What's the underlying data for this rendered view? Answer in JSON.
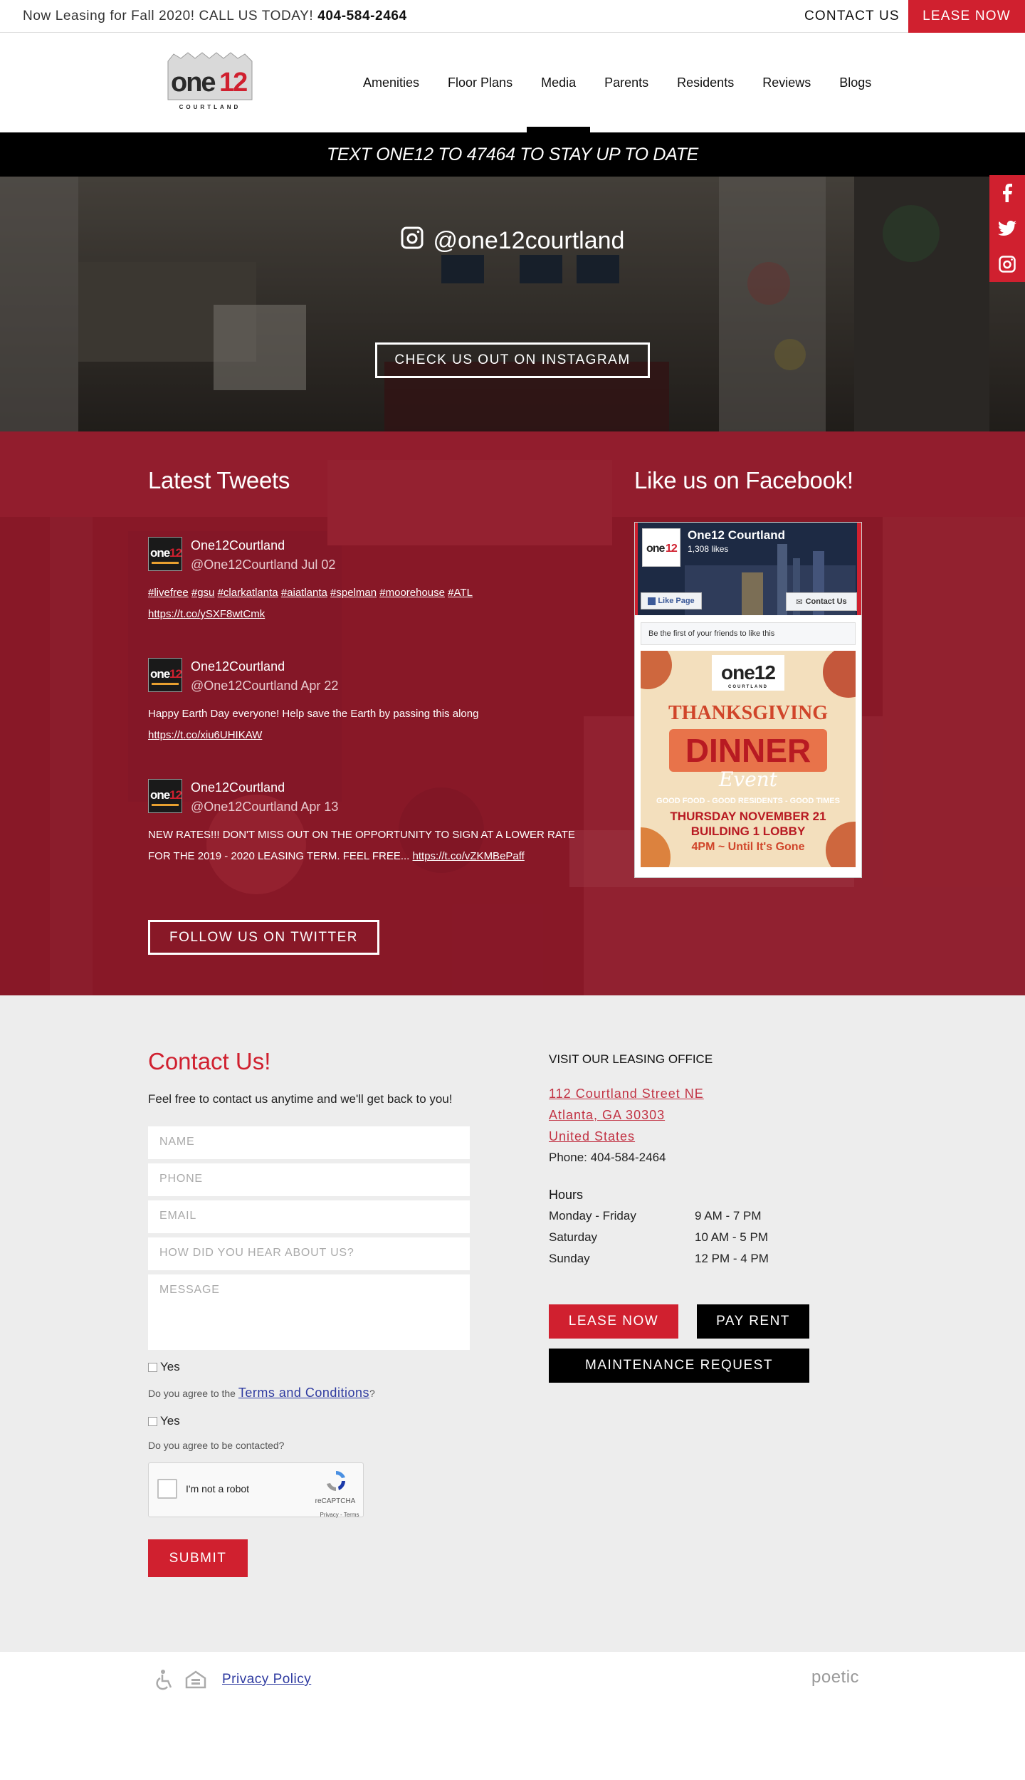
{
  "topbar": {
    "lead_text": "Now Leasing for Fall 2020! CALL US TODAY!",
    "lead_phone": "404-584-2464",
    "contact_label": "CONTACT US",
    "lease_label": "LEASE NOW"
  },
  "header": {
    "logo_text_main": "one12",
    "logo_text_sub": "COURTLAND",
    "nav": [
      {
        "label": "Amenities"
      },
      {
        "label": "Floor Plans"
      },
      {
        "label": "Media",
        "active": true
      },
      {
        "label": "Parents"
      },
      {
        "label": "Residents"
      },
      {
        "label": "Reviews"
      },
      {
        "label": "Blogs"
      }
    ]
  },
  "text_banner": "TEXT ONE12 TO 47464 TO STAY UP TO DATE",
  "instagram": {
    "handle": "@one12courtland",
    "button_label": "CHECK US OUT ON INSTAGRAM"
  },
  "social": {
    "icons": [
      "facebook-icon",
      "twitter-icon",
      "instagram-icon"
    ],
    "accent": "#d0202f"
  },
  "tweets": {
    "heading": "Latest Tweets",
    "items": [
      {
        "name": "One12Courtland",
        "handle_date": "@One12Courtland Jul 02",
        "hashtags": [
          "#livefree",
          "#gsu",
          "#clarkatlanta",
          "#aiatlanta",
          "#spelman",
          "#moorehouse",
          "#ATL"
        ],
        "text": "",
        "link": "https://t.co/ySXF8wtCmk"
      },
      {
        "name": "One12Courtland",
        "handle_date": "@One12Courtland Apr 22",
        "hashtags": [],
        "text": "Happy Earth Day everyone! Help save the Earth by passing this along",
        "link": "https://t.co/xiu6UHIKAW"
      },
      {
        "name": "One12Courtland",
        "handle_date": "@One12Courtland Apr 13",
        "hashtags": [],
        "text": "NEW RATES!!! DON'T MISS OUT ON THE OPPORTUNITY TO SIGN AT A LOWER RATE FOR THE 2019 - 2020 LEASING TERM. FEEL FREE...",
        "link": "https://t.co/vZKMBePaff"
      }
    ],
    "follow_label": "FOLLOW US ON TWITTER"
  },
  "facebook": {
    "heading": "Like us on Facebook!",
    "page_name": "One12 Courtland",
    "likes": "1,308 likes",
    "like_button": "Like Page",
    "contact_button": "Contact Us",
    "friends_text": "Be the first of your friends to like this",
    "poster": {
      "logo_main": "one12",
      "logo_sub": "COURTLAND",
      "line1": "THANKSGIVING",
      "line2": "DINNER",
      "line3": "Event",
      "tagline": "GOOD FOOD - GOOD RESIDENTS - GOOD TIMES",
      "date": "THURSDAY NOVEMBER 21",
      "place": "BUILDING 1 LOBBY",
      "time": "4PM ~ Until It's Gone"
    }
  },
  "contact": {
    "heading": "Contact Us!",
    "intro": "Feel free to contact us anytime and we'll get back to you!",
    "fields": [
      "NAME",
      "PHONE",
      "EMAIL",
      "HOW DID YOU HEAR ABOUT US?",
      "MESSAGE"
    ],
    "yes_label": "Yes",
    "terms_prefix": "Do you agree to the",
    "terms_link": "Terms and Conditions",
    "terms_suffix": "?",
    "contacted_text": "Do you agree to be contacted?",
    "captcha_label": "I'm not a robot",
    "captcha_brand": "reCAPTCHA",
    "captcha_links": "Privacy - Terms",
    "submit_label": "SUBMIT"
  },
  "office": {
    "heading": "VISIT OUR LEASING OFFICE",
    "address": [
      "112 Courtland Street NE",
      "Atlanta, GA 30303",
      "United States"
    ],
    "phone": "Phone: 404-584-2464",
    "hours_heading": "Hours",
    "hours": [
      {
        "day": "Monday - Friday",
        "time": "9 AM - 7 PM"
      },
      {
        "day": "Saturday",
        "time": "10 AM - 5 PM"
      },
      {
        "day": "Sunday",
        "time": "12 PM - 4 PM"
      }
    ],
    "buttons": {
      "lease": "LEASE NOW",
      "pay": "PAY RENT",
      "maintenance": "MAINTENANCE REQUEST"
    }
  },
  "footer": {
    "privacy_label": "Privacy Policy",
    "brand": "poetic",
    "icons": [
      "accessibility-icon",
      "equal-housing-icon"
    ]
  },
  "colors": {
    "brand_red": "#d0202f",
    "dark": "#000000",
    "tweets_bg": "#8c1a2a",
    "contact_bg": "#ededed"
  }
}
